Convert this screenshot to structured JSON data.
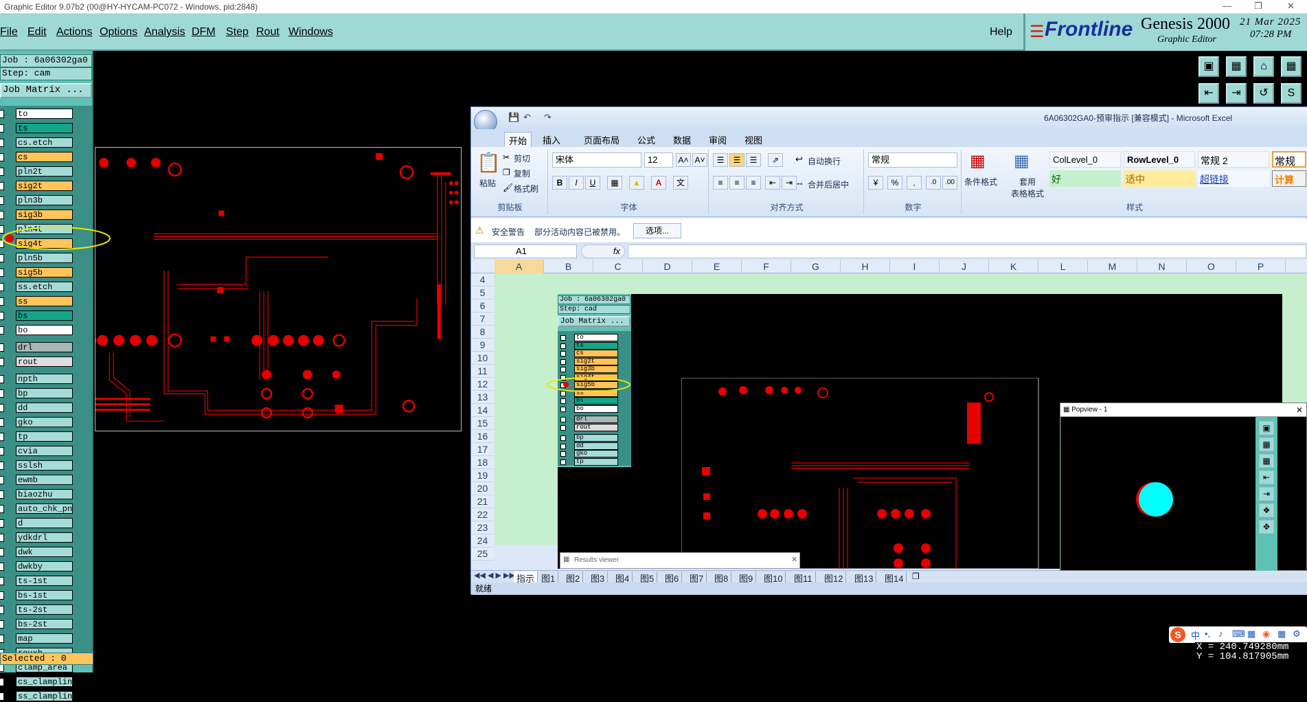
{
  "window": {
    "title": "Graphic Editor 9.07b2 (00@HY-HYCAM-PC072 - Windows, pid:2848)"
  },
  "menu": {
    "items": [
      "File",
      "Edit",
      "Actions",
      "Options",
      "Analysis",
      "DFM",
      "Step",
      "Rout",
      "Windows"
    ],
    "help": "Help"
  },
  "brand": {
    "logo": "Frontline",
    "product": "Genesis 2000",
    "subtitle": "Graphic Editor",
    "date": "21 Mar 2025",
    "time": "07:28 PM"
  },
  "job": {
    "job_label": "Job : 6a06302ga0",
    "step_label": "Step: cam",
    "matrix_button": "Job Matrix ...",
    "selected": "Selected : 0"
  },
  "layers": [
    {
      "name": "to",
      "color": "#ffffff"
    },
    {
      "name": "ts",
      "color": "#14a68a"
    },
    {
      "name": "cs.etch",
      "color": "#a6dcd8"
    },
    {
      "name": "cs",
      "color": "#ffc45a"
    },
    {
      "name": "pln2t",
      "color": "#a6dcd8"
    },
    {
      "name": "sig2t",
      "color": "#ffc45a"
    },
    {
      "name": "pln3b",
      "color": "#a6dcd8"
    },
    {
      "name": "sig3b",
      "color": "#ffc45a"
    },
    {
      "name": "pln4t",
      "color": "#a6dcd8"
    },
    {
      "name": "sig4t",
      "color": "#ffc45a"
    },
    {
      "name": "pln5b",
      "color": "#a6dcd8"
    },
    {
      "name": "sig5b",
      "color": "#ffc45a"
    },
    {
      "name": "ss.etch",
      "color": "#a6dcd8"
    },
    {
      "name": "ss",
      "color": "#ffc45a"
    },
    {
      "name": "bs",
      "color": "#14a68a"
    },
    {
      "name": "bo",
      "color": "#ffffff"
    },
    {
      "name": "drl",
      "color": "#a6b8b8"
    },
    {
      "name": "rout",
      "color": "#dddddd"
    },
    {
      "name": "npth",
      "color": "#a6dcd8"
    },
    {
      "name": "bp",
      "color": "#a6dcd8"
    },
    {
      "name": "dd",
      "color": "#a6dcd8"
    },
    {
      "name": "gko",
      "color": "#a6dcd8"
    },
    {
      "name": "tp",
      "color": "#a6dcd8"
    },
    {
      "name": "cvia",
      "color": "#a6dcd8"
    },
    {
      "name": "sslsh",
      "color": "#a6dcd8"
    },
    {
      "name": "ewmb",
      "color": "#a6dcd8"
    },
    {
      "name": "biaozhu",
      "color": "#a6dcd8"
    },
    {
      "name": "auto_chk_pn",
      "color": "#a6dcd8"
    },
    {
      "name": "d",
      "color": "#a6dcd8"
    },
    {
      "name": "ydkdrl",
      "color": "#a6dcd8"
    },
    {
      "name": "dwk",
      "color": "#a6dcd8"
    },
    {
      "name": "dwkby",
      "color": "#a6dcd8"
    },
    {
      "name": "ts-1st",
      "color": "#a6dcd8"
    },
    {
      "name": "bs-1st",
      "color": "#a6dcd8"
    },
    {
      "name": "ts-2st",
      "color": "#a6dcd8"
    },
    {
      "name": "bs-2st",
      "color": "#a6dcd8"
    },
    {
      "name": "map",
      "color": "#a6dcd8"
    },
    {
      "name": "rouxb",
      "color": "#a6dcd8"
    },
    {
      "name": "clamp_area",
      "color": "#a6dcd8"
    },
    {
      "name": "cs_clampline",
      "color": "#a6dcd8"
    },
    {
      "name": "ss_clampline",
      "color": "#a6dcd8"
    }
  ],
  "coords": {
    "x": "X = 240.749280mm",
    "y": "Y = 104.817905mm"
  },
  "excel": {
    "title": "6A06302GA0-预审指示  [兼容模式] - Microsoft Excel",
    "tabs": [
      "开始",
      "插入",
      "页面布局",
      "公式",
      "数据",
      "审阅",
      "视图"
    ],
    "clipboard": {
      "paste": "粘贴",
      "cut": "剪切",
      "copy": "复制",
      "format_painter": "格式刷",
      "group": "剪贴板"
    },
    "font": {
      "name": "宋体",
      "size": "12",
      "group": "字体"
    },
    "align": {
      "wrap": "自动换行",
      "merge": "合并后居中",
      "group": "对齐方式"
    },
    "number": {
      "format": "常规",
      "group": "数字"
    },
    "styles": {
      "cond": "条件格式",
      "table": "套用\n表格格式",
      "group": "样式",
      "cells": [
        "ColLevel_0",
        "RowLevel_0",
        "常规 2",
        "常规",
        "好",
        "适中",
        "超链接",
        "计算"
      ]
    },
    "security": {
      "label": "安全警告",
      "message": "部分活动内容已被禁用。",
      "options": "选项..."
    },
    "namebox": "A1",
    "fx": "fx",
    "columns": [
      "A",
      "B",
      "C",
      "D",
      "E",
      "F",
      "G",
      "H",
      "I",
      "J",
      "K",
      "L",
      "M",
      "N",
      "O",
      "P"
    ],
    "rows": [
      "4",
      "5",
      "6",
      "7",
      "8",
      "9",
      "10",
      "11",
      "12",
      "13",
      "14",
      "15",
      "16",
      "17",
      "18",
      "19",
      "20",
      "21",
      "22",
      "23",
      "24",
      "25"
    ],
    "sheets": [
      "指示",
      "图1",
      "图2",
      "图3",
      "图4",
      "图5",
      "图6",
      "图7",
      "图8",
      "图9",
      "图10",
      "图11",
      "图12",
      "图13",
      "图14"
    ],
    "status": "就绪"
  },
  "inner": {
    "job_label": "Job : 6a06302ga0",
    "step_label": "Step: cad",
    "matrix_button": "Job Matrix ...",
    "layers": [
      "to",
      "ts",
      "cs",
      "sig2t",
      "sig3b",
      "sig4t",
      "sig5b",
      "ss",
      "bs",
      "bo",
      "drl",
      "rout",
      "bp",
      "dd",
      "gko",
      "tp"
    ]
  },
  "popview": {
    "title": "Popview - 1"
  },
  "results": {
    "title": "Results viewer"
  }
}
